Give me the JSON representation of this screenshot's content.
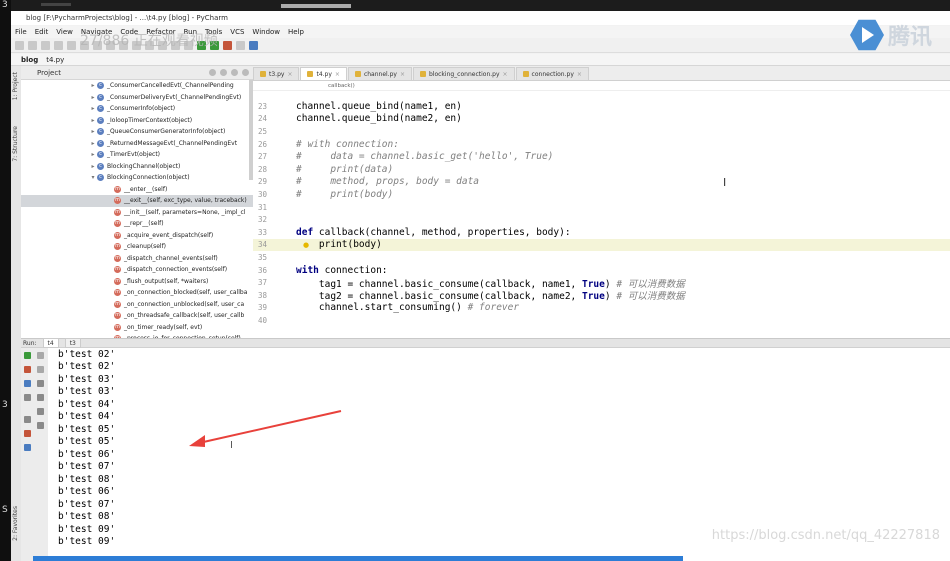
{
  "title": "blog [F:\\PycharmProjects\\blog] - ...\\t4.py [blog] - PyCharm",
  "menu": [
    "File",
    "Edit",
    "View",
    "Navigate",
    "Code",
    "Refactor",
    "Run",
    "Tools",
    "VCS",
    "Window",
    "Help"
  ],
  "overlay_text": "27/886 正在观看视频",
  "nav": [
    "blog",
    "t4.py"
  ],
  "project_panel": {
    "label": "Project",
    "items": [
      {
        "kind": "c",
        "text": "_ConsumerCancelledEvt(_ChannelPending"
      },
      {
        "kind": "c",
        "text": "_ConsumerDeliveryEvt(_ChannelPendingEvt)"
      },
      {
        "kind": "c",
        "text": "_ConsumerInfo(object)"
      },
      {
        "kind": "c",
        "text": "_IoloopTimerContext(object)"
      },
      {
        "kind": "c",
        "text": "_QueueConsumerGeneratorInfo(object)"
      },
      {
        "kind": "c",
        "text": "_ReturnedMessageEvt(_ChannelPendingEvt"
      },
      {
        "kind": "c",
        "text": "_TimerEvt(object)"
      },
      {
        "kind": "c",
        "text": "BlockingChannel(object)"
      },
      {
        "kind": "c",
        "text": "BlockingConnection(object)",
        "open": true
      },
      {
        "kind": "m",
        "text": "__enter__(self)"
      },
      {
        "kind": "m",
        "text": "__exit__(self, exc_type, value, traceback)",
        "selected": true
      },
      {
        "kind": "m",
        "text": "__init__(self, parameters=None, _impl_cl"
      },
      {
        "kind": "m",
        "text": "__repr__(self)"
      },
      {
        "kind": "m",
        "text": "_acquire_event_dispatch(self)"
      },
      {
        "kind": "m",
        "text": "_cleanup(self)"
      },
      {
        "kind": "m",
        "text": "_dispatch_channel_events(self)"
      },
      {
        "kind": "m",
        "text": "_dispatch_connection_events(self)"
      },
      {
        "kind": "m",
        "text": "_flush_output(self, *waiters)"
      },
      {
        "kind": "m",
        "text": "_on_connection_blocked(self, user_callba"
      },
      {
        "kind": "m",
        "text": "_on_connection_unblocked(self, user_ca"
      },
      {
        "kind": "m",
        "text": "_on_threadsafe_callback(self, user_callb"
      },
      {
        "kind": "m",
        "text": "_on_timer_ready(self, evt)"
      },
      {
        "kind": "m",
        "text": "_process_io_for_connection_setup(self)"
      }
    ]
  },
  "tabs": [
    {
      "label": "t3.py",
      "active": false
    },
    {
      "label": "t4.py",
      "active": true
    },
    {
      "label": "channel.py",
      "active": false
    },
    {
      "label": "blocking_connection.py",
      "active": false
    },
    {
      "label": "connection.py",
      "active": false
    }
  ],
  "editor_crumb": "callback()",
  "code": [
    {
      "n": "23",
      "cls": "plain",
      "html": "channel.queue_bind(name1, en)"
    },
    {
      "n": "24",
      "cls": "plain",
      "html": "channel.queue_bind(name2, en)"
    },
    {
      "n": "25",
      "cls": "plain",
      "html": ""
    },
    {
      "n": "26",
      "cls": "comment",
      "html": "# with connection:"
    },
    {
      "n": "27",
      "cls": "comment",
      "html": "#     data = channel.basic_get('hello', True)"
    },
    {
      "n": "28",
      "cls": "comment",
      "html": "#     print(data)"
    },
    {
      "n": "29",
      "cls": "comment",
      "html": "#     method, props, body = data"
    },
    {
      "n": "30",
      "cls": "comment",
      "html": "#     print(body)"
    },
    {
      "n": "31",
      "cls": "plain",
      "html": ""
    },
    {
      "n": "32",
      "cls": "plain",
      "html": ""
    },
    {
      "n": "33",
      "cls": "plain",
      "html": "def callback(channel, method, properties, body):"
    },
    {
      "n": "34",
      "cls": "plain",
      "html": "    print(body)",
      "highlight": true
    },
    {
      "n": "35",
      "cls": "plain",
      "html": ""
    },
    {
      "n": "36",
      "cls": "plain",
      "html": "with connection:"
    },
    {
      "n": "37",
      "cls": "plain",
      "html": "    tag1 = channel.basic_consume(callback, name1, True) # 可以消费数据"
    },
    {
      "n": "38",
      "cls": "plain",
      "html": "    tag2 = channel.basic_consume(callback, name2, True) # 可以消费数据"
    },
    {
      "n": "39",
      "cls": "plain",
      "html": "    channel.start_consuming() # forever"
    },
    {
      "n": "40",
      "cls": "plain",
      "html": ""
    }
  ],
  "run": {
    "label": "Run:",
    "tabs": [
      "t4",
      "t3"
    ],
    "output": [
      "b'test 02'",
      "b'test 02'",
      "b'test 03'",
      "b'test 03'",
      "b'test 04'",
      "b'test 04'",
      "b'test 05'",
      "b'test 05'",
      "b'test 06'",
      "b'test 07'",
      "b'test 08'",
      "b'test 06'",
      "b'test 07'",
      "b'test 08'",
      "b'test 09'",
      "b'test 09'"
    ]
  },
  "watermark": "https://blog.csdn.net/qq_42227818",
  "brand": "腾讯",
  "colors": {
    "annotation_arrow": "#e8413b",
    "keyword": "#000080",
    "comment": "#808080",
    "selection": "#d3d6da",
    "current_line": "#f4f4d8"
  }
}
